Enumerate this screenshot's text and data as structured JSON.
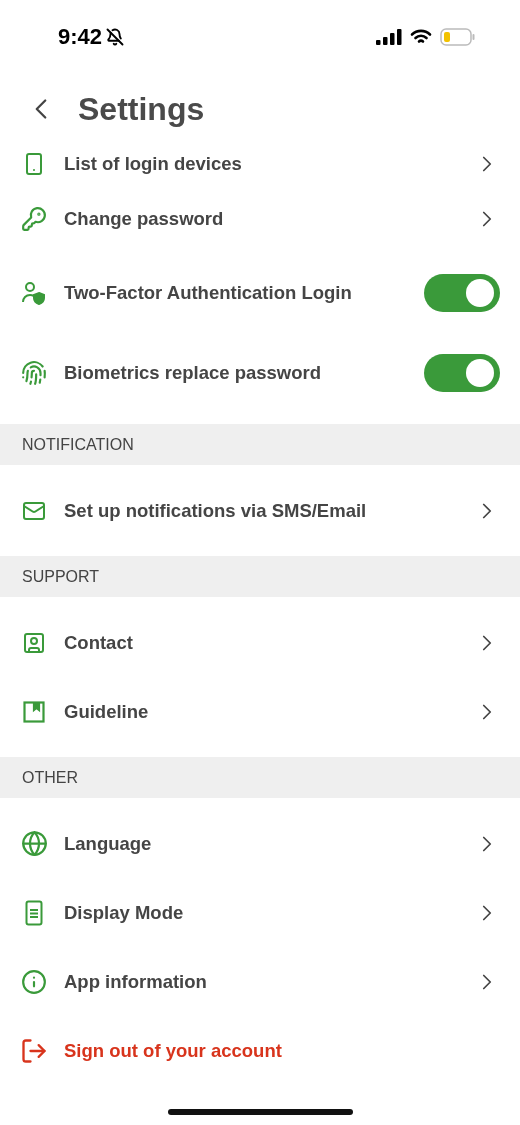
{
  "status_bar": {
    "time": "9:42"
  },
  "header": {
    "title": "Settings"
  },
  "sections": [
    {
      "items": [
        {
          "kind": "link",
          "label": "List of login devices"
        },
        {
          "kind": "link",
          "label": "Change password"
        },
        {
          "kind": "toggle",
          "label": "Two-Factor Authentication Login",
          "on": true
        },
        {
          "kind": "toggle",
          "label": "Biometrics replace password",
          "on": true
        }
      ]
    },
    {
      "title": "NOTIFICATION",
      "items": [
        {
          "kind": "link",
          "label": "Set up notifications via SMS/Email"
        }
      ]
    },
    {
      "title": "SUPPORT",
      "items": [
        {
          "kind": "link",
          "label": "Contact"
        },
        {
          "kind": "link",
          "label": "Guideline"
        }
      ]
    },
    {
      "title": "OTHER",
      "items": [
        {
          "kind": "link",
          "label": "Language"
        },
        {
          "kind": "link",
          "label": "Display Mode"
        },
        {
          "kind": "link",
          "label": "App information"
        },
        {
          "kind": "danger",
          "label": "Sign out of your account"
        }
      ]
    }
  ]
}
